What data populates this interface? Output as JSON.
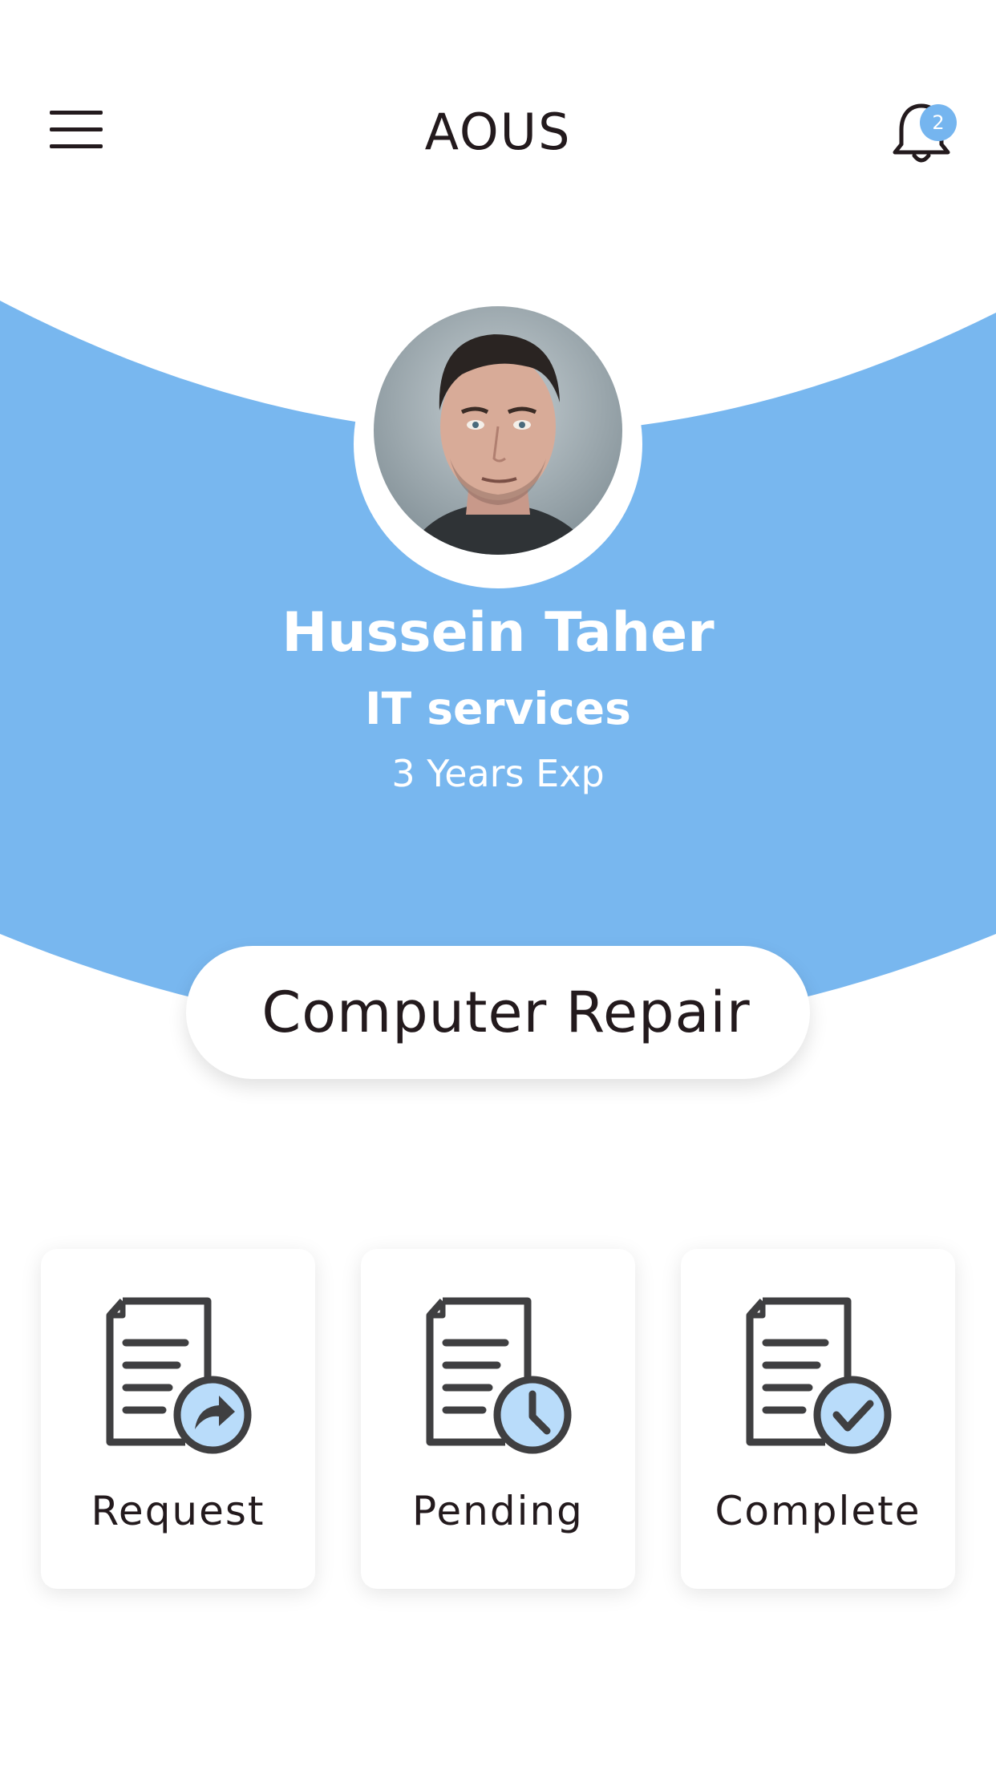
{
  "header": {
    "title": "AOUS",
    "notification_count": "2"
  },
  "profile": {
    "name": "Hussein Taher",
    "role": "IT services",
    "experience": "3 Years Exp"
  },
  "service": {
    "label": "Computer Repair"
  },
  "cards": [
    {
      "label": "Request",
      "icon": "document-share-icon"
    },
    {
      "label": "Pending",
      "icon": "document-clock-icon"
    },
    {
      "label": "Complete",
      "icon": "document-check-icon"
    }
  ],
  "colors": {
    "accent": "#75b5ef",
    "text": "#231a1d",
    "icon_stroke": "#3f3f41",
    "icon_fill": "#b9dcfa"
  }
}
